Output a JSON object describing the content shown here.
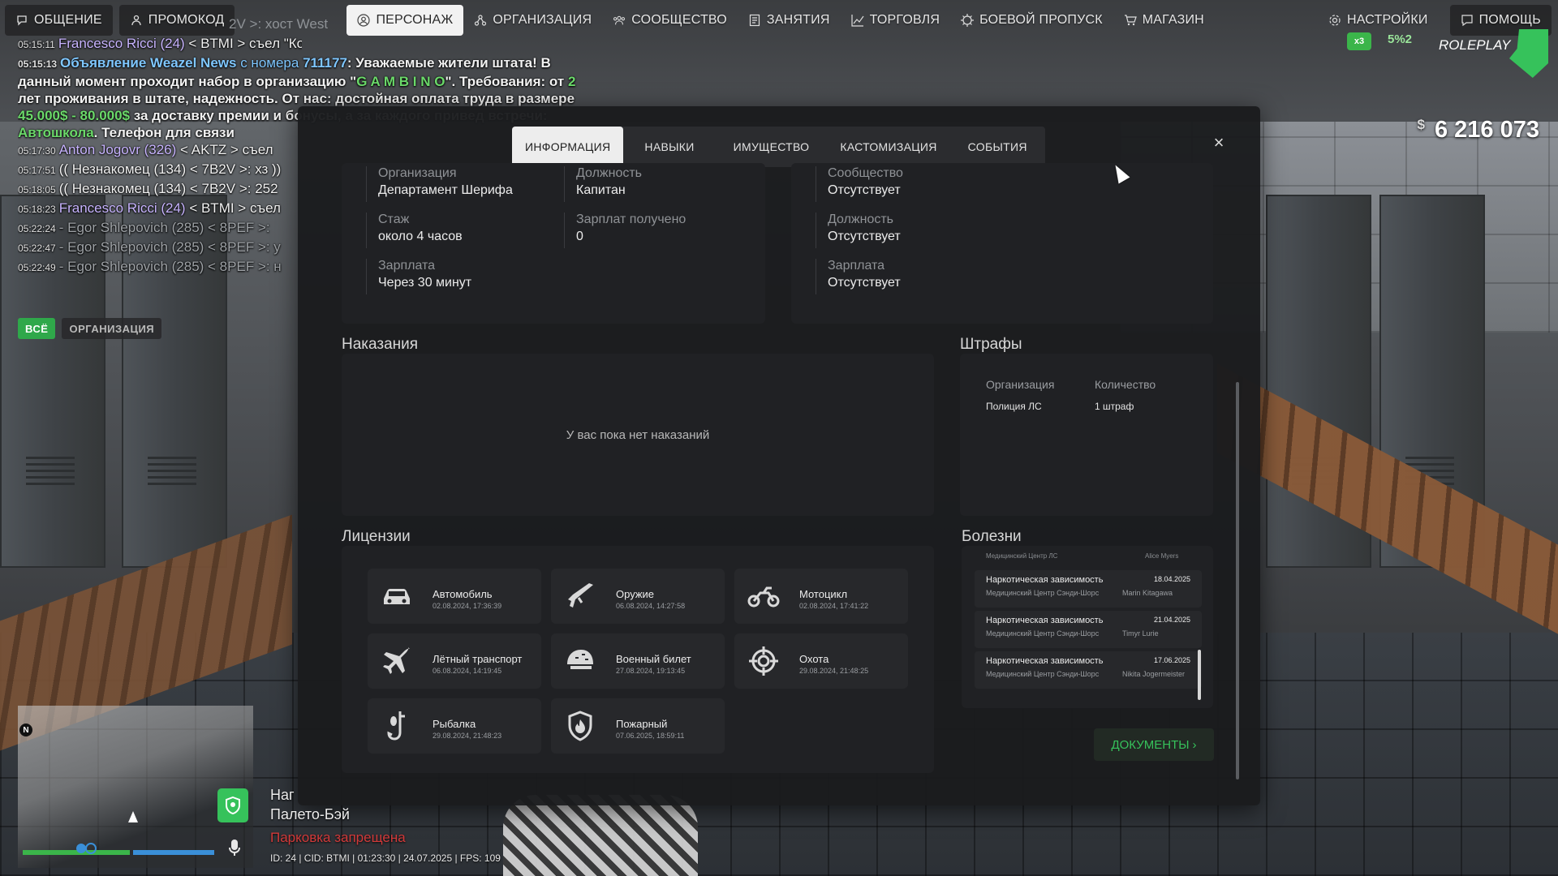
{
  "nav": {
    "left": [
      {
        "icon": "chat-icon",
        "label": "ОБЩЕНИЕ"
      },
      {
        "icon": "person-icon",
        "label": "ПРОМОКОД"
      }
    ],
    "center": [
      {
        "icon": "person-icon",
        "label": "ПЕРСОНАЖ",
        "active": true
      },
      {
        "icon": "organization-icon",
        "label": "ОРГАНИЗАЦИЯ"
      },
      {
        "icon": "community-icon",
        "label": "СООБЩЕСТВО"
      },
      {
        "icon": "activities-icon",
        "label": "ЗАНЯТИЯ"
      },
      {
        "icon": "trade-chart-icon",
        "label": "ТОРГОВЛЯ"
      },
      {
        "icon": "battle-pass-icon",
        "label": "БОЕВОЙ ПРОПУСК"
      },
      {
        "icon": "cart-icon",
        "label": "МАГАЗИН"
      }
    ],
    "right": [
      {
        "icon": "gear-icon",
        "label": "НАСТРОЙКИ"
      },
      {
        "icon": "help-icon",
        "label": "ПОМОЩЬ"
      }
    ]
  },
  "chat": {
    "ghost": "2V >: хост West",
    "lines": [
      {
        "time": "05:15:11",
        "who": "Francesco Ricci (24)",
        "text": " < BTMI > съел \"Конфета\""
      },
      {
        "time": "05:15:13",
        "news": "Объявление Weazel News",
        "text": " с номера ",
        "num": "711177",
        "body": ": Уважаемые жители штата! В данный момент проходит набор в организацию \"",
        "org": "G A M B I N O",
        "body2": "\". Требования: от ",
        "n2": "2",
        "body3": " лет проживания в штате, надежность. От нас: достойная оплата труда в размере ",
        "pay": "45.000$ - 80.000$",
        "body4": " за доставку премии и бонусы, а за каждого привед встречи: ",
        "school": "Автошкола",
        "body5": ". Телефон для связи"
      },
      {
        "time": "05:17:30",
        "who": "Anton Jogovr (326)",
        "text": " < AKTZ > съел"
      },
      {
        "time": "05:17:51",
        "text": "(( Незнакомец (134) < 7B2V >: хз ))"
      },
      {
        "time": "05:18:05",
        "text": "(( Незнакомец (134) < 7B2V >: 252"
      },
      {
        "time": "05:18:23",
        "who": "Francesco Ricci (24)",
        "text": " < BTMI > съел"
      },
      {
        "time": "05:22:24",
        "text": "- Egor Shlepovich (285) < 8PEF >:",
        "faded": true
      },
      {
        "time": "05:22:47",
        "text": "- Egor Shlepovich (285) < 8PEF >: у",
        "faded": true
      },
      {
        "time": "05:22:49",
        "text": "- Egor Shlepovich (285) < 8PEF >: н",
        "faded": true
      }
    ],
    "tabs": [
      "ВСЁ",
      "ОРГАНИЗАЦИЯ"
    ]
  },
  "hud": {
    "money_symbol": "$",
    "money": "6 216 073",
    "badge_x": "x3",
    "badge_x2": "5%2",
    "logo": "ROLEPLAY",
    "location_line1": "Наг",
    "location_line2": "Палето-Бэй",
    "parking": "Парковка запрещена",
    "status": "ID: 24 | CID: BTMI | 01:23:30 | 24.07.2025 | FPS: 109",
    "north": "N",
    "health_pct": 56,
    "armor_pct": 42
  },
  "modal": {
    "tabs": [
      "ИНФОРМАЦИЯ",
      "НАВЫКИ",
      "ИМУЩЕСТВО",
      "КАСТОМИЗАЦИЯ",
      "СОБЫТИЯ"
    ],
    "active_tab": "ИНФОРМАЦИЯ",
    "close": "×",
    "org_info": {
      "org_label": "Организация",
      "org_value": "Департамент Шерифа",
      "pos_label": "Должность",
      "pos_value": "Капитан",
      "exp_label": "Стаж",
      "exp_value": "около 4 часов",
      "paid_label": "Зарплат получено",
      "paid_value": "0",
      "salary_label": "Зарплата",
      "salary_value": "Через 30 минут"
    },
    "community": {
      "comm_label": "Сообщество",
      "comm_value": "Отсутствует",
      "pos_label": "Должность",
      "pos_value": "Отсутствует",
      "salary_label": "Зарплата",
      "salary_value": "Отсутствует"
    },
    "punishments": {
      "title": "Наказания",
      "empty": "У вас пока нет наказаний"
    },
    "fines": {
      "title": "Штрафы",
      "col_org": "Организация",
      "col_count": "Количество",
      "rows": [
        {
          "org": "Полиция ЛС",
          "count": "1 штраф"
        }
      ]
    },
    "licenses": {
      "title": "Лицензии",
      "items": [
        {
          "icon": "car-icon",
          "name": "Автомобиль",
          "date": "02.08.2024, 17:36:39"
        },
        {
          "icon": "rifle-icon",
          "name": "Оружие",
          "date": "06.08.2024, 14:27:58"
        },
        {
          "icon": "motorcycle-icon",
          "name": "Мотоцикл",
          "date": "02.08.2024, 17:41:22"
        },
        {
          "icon": "airplane-icon",
          "name": "Лётный транспорт",
          "date": "06.08.2024, 14:19:45"
        },
        {
          "icon": "military-helmet-icon",
          "name": "Военный билет",
          "date": "27.08.2024, 19:13:45"
        },
        {
          "icon": "crosshair-icon",
          "name": "Охота",
          "date": "29.08.2024, 21:48:25"
        },
        {
          "icon": "fishing-icon",
          "name": "Рыбалка",
          "date": "29.08.2024, 21:48:23"
        },
        {
          "icon": "fire-shield-icon",
          "name": "Пожарный",
          "date": "07.06.2025, 18:59:11"
        }
      ]
    },
    "illnesses": {
      "title": "Болезни",
      "partial_place": "Медицинский Центр ЛС",
      "partial_doc": "Alice Myers",
      "rows": [
        {
          "name": "Наркотическая зависимость",
          "date": "18.04.2025",
          "place": "Медицинский Центр Сэнди-Шорс",
          "doctor": "Marin Kitagawa"
        },
        {
          "name": "Наркотическая зависимость",
          "date": "21.04.2025",
          "place": "Медицинский Центр Сэнди-Шорс",
          "doctor": "Timyr Lurie"
        },
        {
          "name": "Наркотическая зависимость",
          "date": "17.06.2025",
          "place": "Медицинский Центр Сэнди-Шорс",
          "doctor": "Nikita Jogermeister"
        }
      ]
    },
    "docs_button": "ДОКУМЕНТЫ",
    "docs_chevron": "›"
  }
}
